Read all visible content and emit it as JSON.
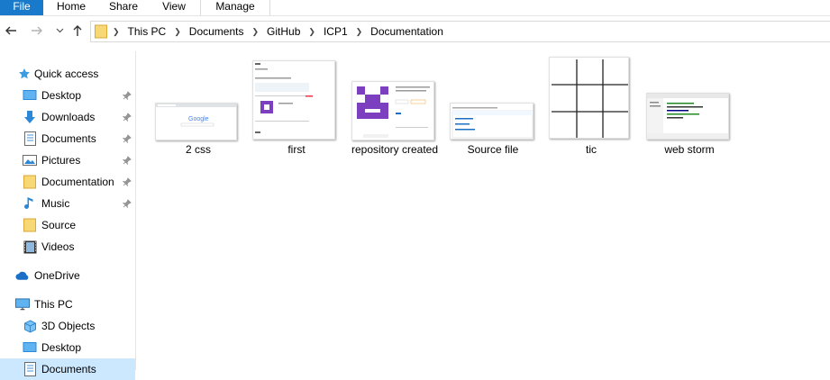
{
  "ribbon": {
    "tabs": [
      "File",
      "Home",
      "Share",
      "View",
      "Manage"
    ]
  },
  "address": {
    "crumbs": [
      "This PC",
      "Documents",
      "GitHub",
      "ICP1",
      "Documentation"
    ]
  },
  "nav": {
    "quick_access": "Quick access",
    "items": [
      "Desktop",
      "Downloads",
      "Documents",
      "Pictures",
      "Documentation",
      "Music",
      "Source",
      "Videos"
    ],
    "onedrive": "OneDrive",
    "this_pc": "This PC",
    "pc_items": [
      "3D Objects",
      "Desktop",
      "Documents"
    ]
  },
  "files": [
    {
      "name": "2 css",
      "thumb": "browser-google"
    },
    {
      "name": "first",
      "thumb": "document-page"
    },
    {
      "name": "repository created",
      "thumb": "github-repo"
    },
    {
      "name": "Source file",
      "thumb": "github-files"
    },
    {
      "name": "tic",
      "thumb": "tic-tac-toe-grid"
    },
    {
      "name": "web storm",
      "thumb": "ide-window"
    }
  ],
  "colors": {
    "accent": "#1979ca",
    "folder": "#f8d775",
    "selection": "#cce8ff",
    "purple": "#7c3fbf"
  }
}
